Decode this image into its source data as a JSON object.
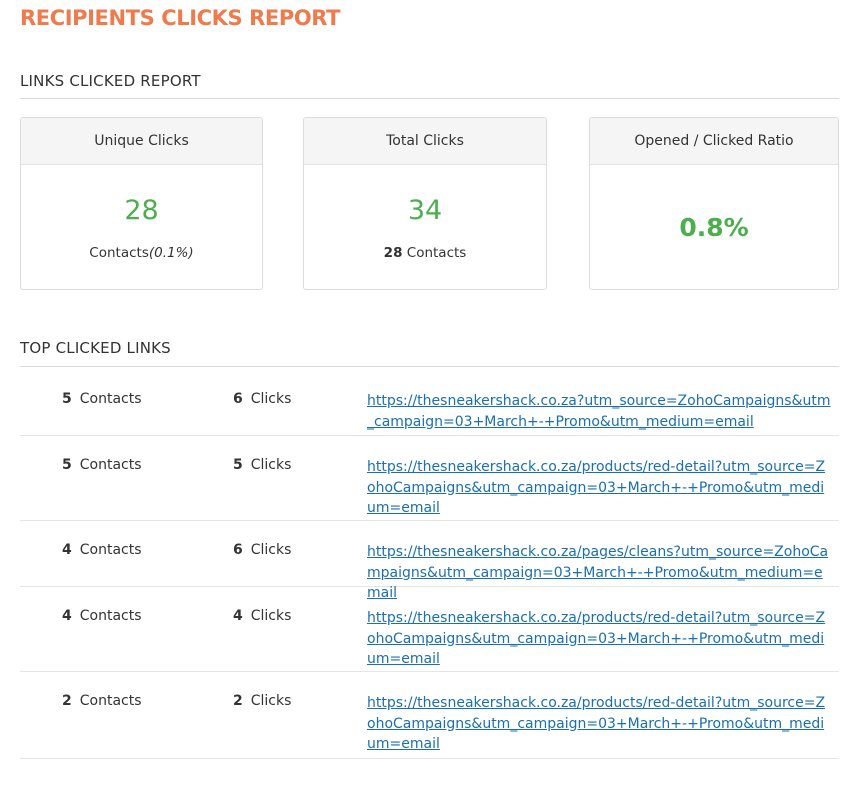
{
  "page": {
    "title": "RECIPIENTS CLICKS REPORT"
  },
  "links_report": {
    "section_title": "LINKS CLICKED REPORT",
    "cards": {
      "unique": {
        "label": "Unique Clicks",
        "value": "28",
        "sub_text": "Contacts",
        "sub_pct": "(0.1%)"
      },
      "total": {
        "label": "Total Clicks",
        "value": "34",
        "sub_count": "28",
        "sub_text": "Contacts"
      },
      "ratio": {
        "label": "Opened / Clicked Ratio",
        "value": "0.8%"
      }
    }
  },
  "top_links": {
    "section_title": "TOP CLICKED LINKS",
    "contacts_label": "Contacts",
    "clicks_label": "Clicks",
    "rows": [
      {
        "contacts": "5",
        "clicks": "6",
        "url": "https://thesneakershack.co.za?utm_source=ZohoCampaigns&utm_campaign=03+March+-+Promo&utm_medium=email"
      },
      {
        "contacts": "5",
        "clicks": "5",
        "url": "https://thesneakershack.co.za/products/red-detail?utm_source=ZohoCampaigns&utm_campaign=03+March+-+Promo&utm_medium=email"
      },
      {
        "contacts": "4",
        "clicks": "6",
        "url": "https://thesneakershack.co.za/pages/cleans?utm_source=ZohoCampaigns&utm_campaign=03+March+-+Promo&utm_medium=email"
      },
      {
        "contacts": "4",
        "clicks": "4",
        "url": "https://thesneakershack.co.za/products/red-detail?utm_source=ZohoCampaigns&utm_campaign=03+March+-+Promo&utm_medium=email"
      },
      {
        "contacts": "2",
        "clicks": "2",
        "url": "https://thesneakershack.co.za/products/red-detail?utm_source=ZohoCampaigns&utm_campaign=03+March+-+Promo&utm_medium=email"
      }
    ]
  },
  "colors": {
    "title_accent": "#ef7a4c",
    "metric_green": "#4cae4c",
    "link_blue": "#1a6fb0"
  }
}
